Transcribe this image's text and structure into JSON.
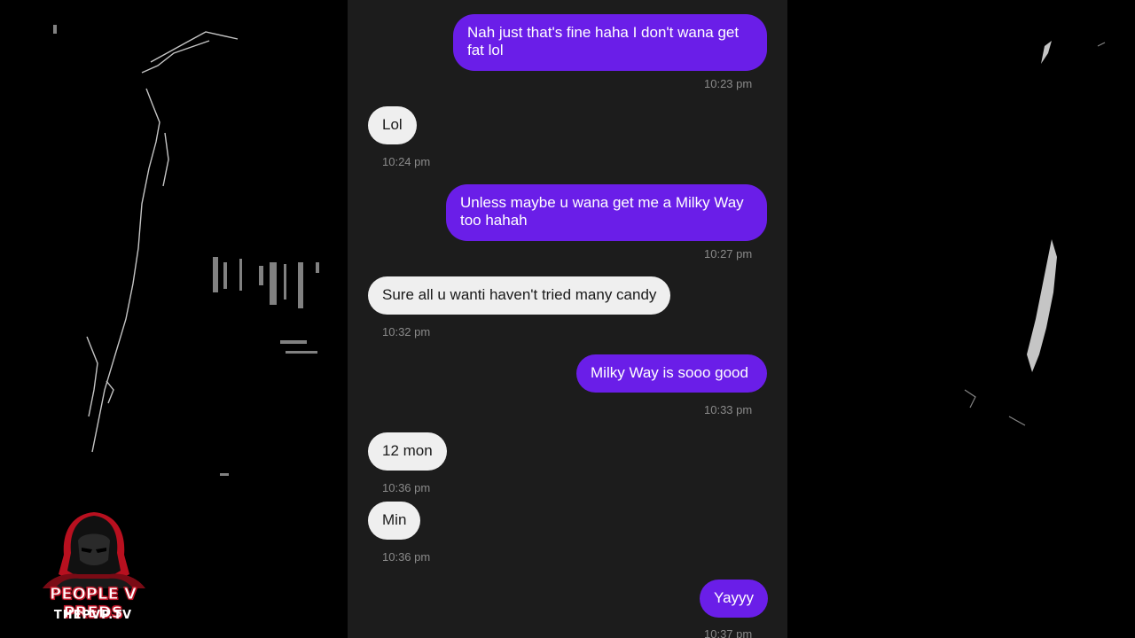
{
  "messages": [
    {
      "text": "Nah just that's fine haha I don't wana get fat lol",
      "time": "10:23 pm",
      "direction": "sent"
    },
    {
      "text": "Lol",
      "time": "10:24 pm",
      "direction": "received"
    },
    {
      "text": "Unless maybe u wana get me a Milky Way too hahah",
      "time": "10:27 pm",
      "direction": "sent"
    },
    {
      "text": "Sure all u wanti haven't tried many candy",
      "time": "10:32 pm",
      "direction": "received"
    },
    {
      "text": "Milky Way is sooo good",
      "time": "10:33 pm",
      "direction": "sent"
    },
    {
      "text": "12 mon",
      "time": "10:36 pm",
      "direction": "received"
    },
    {
      "text": "Min",
      "time": "10:36 pm",
      "direction": "received"
    },
    {
      "text": "Yayyy",
      "time": "10:37 pm",
      "direction": "sent"
    }
  ],
  "logo": {
    "title": "PEOPLE V PREDS",
    "subtitle": "THEPVP.TV"
  },
  "colors": {
    "sent_bubble": "#6a1ee8",
    "received_bubble": "#efefef",
    "panel_background": "#1c1c1c",
    "timestamp": "#8a8a8a",
    "logo_accent": "#c0182a"
  }
}
